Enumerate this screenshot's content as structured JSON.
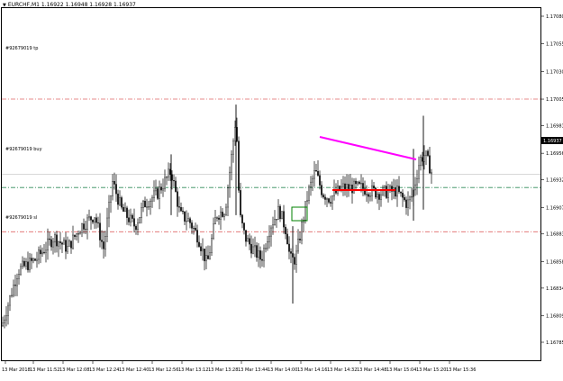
{
  "window": {
    "title": "EURCHF,M1  1.16922 1.16948 1.16928 1.16937"
  },
  "orders": {
    "tp_label": "#92679019 tp",
    "buy_label": "#92679019 buy",
    "sl_label": "#92679019 sl"
  },
  "colors": {
    "candles": "#000000",
    "tp_line": "#e06666",
    "sl_line": "#e06666",
    "buy_line": "#2e8b57",
    "trendline_top": "#ff00ff",
    "trendline_bottom": "#ff0000",
    "marker_box": "#008000"
  },
  "chart_data": {
    "type": "candlestick",
    "symbol": "EURCHF",
    "timeframe": "M1",
    "bid": "1.16937",
    "y_ticks": [
      "1.17080",
      "1.17055",
      "1.17030",
      "1.17005",
      "1.16981",
      "1.16956",
      "1.16932",
      "1.16907",
      "1.16883",
      "1.16858",
      "1.16834",
      "1.16809",
      "1.16785"
    ],
    "y_range": [
      1.16775,
      1.17095
    ],
    "x_ticks": [
      "13 Mar 2018",
      "13 Mar 11:52",
      "13 Mar 12:08",
      "13 Mar 12:24",
      "13 Mar 12:40",
      "13 Mar 12:56",
      "13 Mar 13:12",
      "13 Mar 13:28",
      "13 Mar 13:44",
      "13 Mar 14:00",
      "13 Mar 14:16",
      "13 Mar 14:32",
      "13 Mar 14:48",
      "13 Mar 15:04",
      "13 Mar 15:20",
      "13 Mar 15:36"
    ],
    "levels": {
      "tp": 1.17005,
      "buy": 1.16925,
      "sl": 1.16885
    },
    "current_price": 1.16937
  }
}
